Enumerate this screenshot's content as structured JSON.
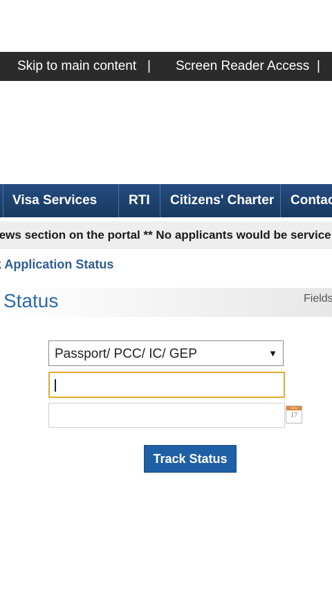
{
  "topbar": {
    "skip_link": "Skip to main content",
    "screen_reader": "Screen Reader Access",
    "divider": "|"
  },
  "nav": {
    "items": [
      {
        "label": "Visa Services"
      },
      {
        "label": "RTI"
      },
      {
        "label": "Citizens' Charter"
      },
      {
        "label": "Contac"
      }
    ]
  },
  "ticker": {
    "text": "lews section on the portal ** No applicants would be service"
  },
  "breadcrumb": {
    "current": "k Application Status"
  },
  "form": {
    "title": "Status",
    "fields_note": "Fields",
    "service_type": {
      "selected": "Passport/ PCC/ IC/ GEP",
      "arrow": "▼"
    },
    "file_number": {
      "value": ""
    },
    "date_of_birth": {
      "value": ""
    },
    "calendar": {
      "month": "MON",
      "day": "17"
    },
    "submit_label": "Track Status"
  },
  "colors": {
    "topbar_bg": "#2b2b2b",
    "nav_bg": "#1f4474",
    "accent_blue": "#2f6aa8",
    "focus_border": "#e3a92a",
    "button_bg": "#1f5fa5"
  }
}
